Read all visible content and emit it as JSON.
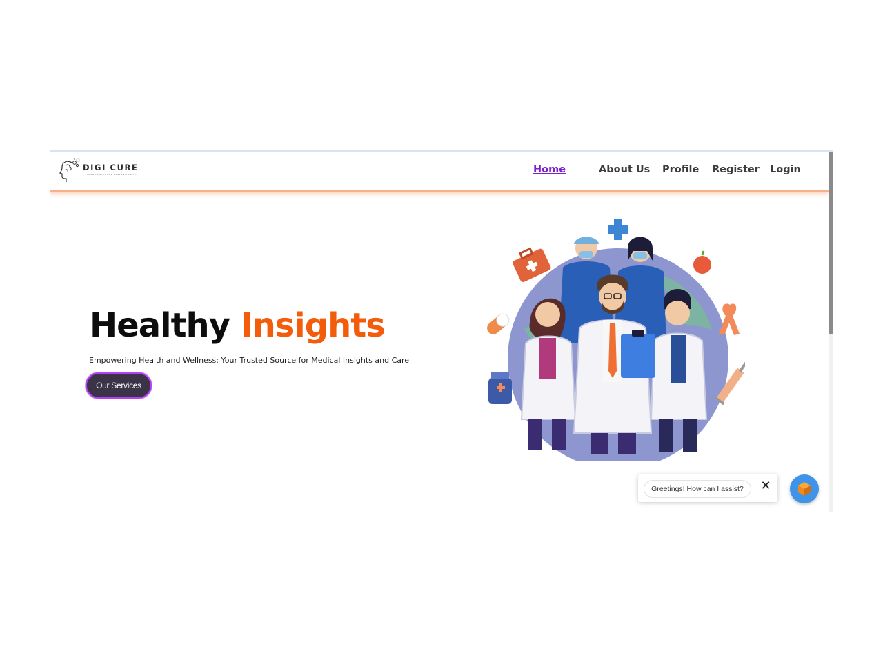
{
  "logo": {
    "name": "DIGI CURE",
    "tagline": "YOUR HEALTH OUR RESPONSIBILITY"
  },
  "nav": {
    "items": [
      {
        "label": "Home",
        "active": true
      },
      {
        "label": "About Us",
        "active": false
      },
      {
        "label": "Profile",
        "active": false
      },
      {
        "label": "Register",
        "active": false
      },
      {
        "label": "Login",
        "active": false
      }
    ]
  },
  "hero": {
    "title_part1": "Healthy",
    "title_part2": "Insights",
    "subtitle": "Empowering Health and Wellness: Your Trusted Source for Medical Insights and Care",
    "cta_label": "Our Services"
  },
  "chat": {
    "greeting": "Greetings! How can I assist?",
    "close_symbol": "✕"
  },
  "colors": {
    "accent_orange": "#f25c0b",
    "nav_active": "#7b1fcf",
    "cta_bg": "#3b3347",
    "cta_border": "#b640f2",
    "chat_launcher": "#3f94ea"
  },
  "icons": [
    "brain-head-logo-icon",
    "close-icon",
    "chatbot-cube-icon",
    "medical-team-illustration"
  ]
}
